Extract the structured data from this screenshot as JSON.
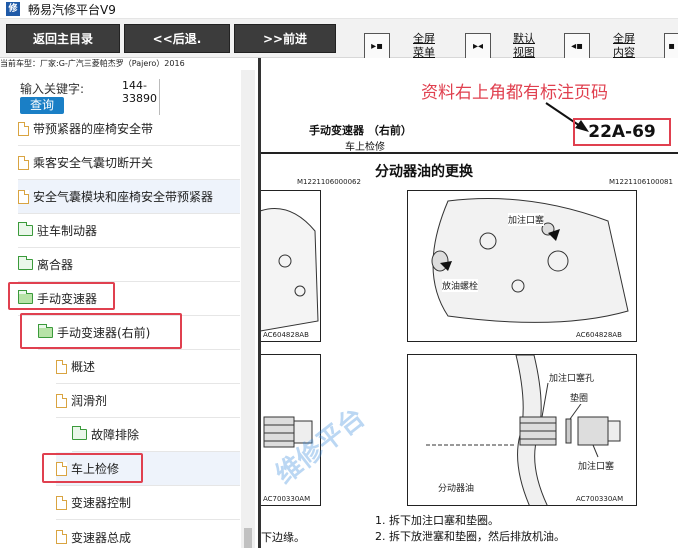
{
  "window": {
    "title": "畅易汽修平台V9",
    "icon": "app-logo-icon"
  },
  "toolbar": {
    "back_main": "返回主目录",
    "back": "<<后退.",
    "forward": ">>前进",
    "tools": [
      {
        "icon": "fullscreen-menu-icon",
        "label_line1": "全屏",
        "label_line2": "菜单"
      },
      {
        "icon": "default-view-icon",
        "label_line1": "默认",
        "label_line2": "视图"
      },
      {
        "icon": "fullscreen-content-icon",
        "label_line1": "全屏",
        "label_line2": "内容"
      }
    ]
  },
  "current_car": "当前车型：厂家:G-广汽三菱帕杰罗（Pajero）2016",
  "search": {
    "label": "输入关键字:",
    "value_line1": "144-",
    "value_line2": "33890",
    "button": "查询"
  },
  "tree": [
    {
      "label": "带预紧器的座椅安全带",
      "icon": "document-icon"
    },
    {
      "label": "乘客安全气囊切断开关",
      "icon": "document-icon"
    },
    {
      "label": "安全气囊模块和座椅安全带预紧器",
      "icon": "document-icon"
    },
    {
      "label": "驻车制动器",
      "icon": "folder-icon"
    },
    {
      "label": "离合器",
      "icon": "folder-icon"
    },
    {
      "label": "手动变速器",
      "icon": "folder-open-icon"
    },
    {
      "label": "手动变速器(右前)",
      "icon": "folder-open-icon"
    },
    {
      "label": "概述",
      "icon": "document-icon"
    },
    {
      "label": "润滑剂",
      "icon": "document-icon"
    },
    {
      "label": "故障排除",
      "icon": "folder-icon"
    },
    {
      "label": "车上检修",
      "icon": "document-icon"
    },
    {
      "label": "变速器控制",
      "icon": "document-icon"
    },
    {
      "label": "变速器总成",
      "icon": "document-icon"
    }
  ],
  "document": {
    "annotation": "资料右上角都有标注页码",
    "page_code": "22A-69",
    "section_title": "手动变速器 （右前）",
    "section_sub": "车上检修",
    "heading": "分动器油的更换",
    "fig_code_left": "M1221106000062",
    "fig_code_right": "M1221106100081",
    "fig_top_right": {
      "label_fill": "加注口塞",
      "label_drain": "放油螺栓",
      "code": "AC604828AB"
    },
    "fig_top_left_code": "AC604828AB",
    "fig_bottom_right": {
      "label_plug": "加注口塞孔",
      "label_gasket": "垫圈",
      "label_fill": "加注口塞",
      "label_oil": "分动器油",
      "code": "AC700330AM"
    },
    "fig_bottom_left_code": "AC700330AM",
    "left_step": "下边缘。",
    "steps": [
      "1. 拆下加注口塞和垫圈。",
      "2. 拆下放泄塞和垫圈，然后排放机油。"
    ],
    "watermark": "维修平台"
  }
}
